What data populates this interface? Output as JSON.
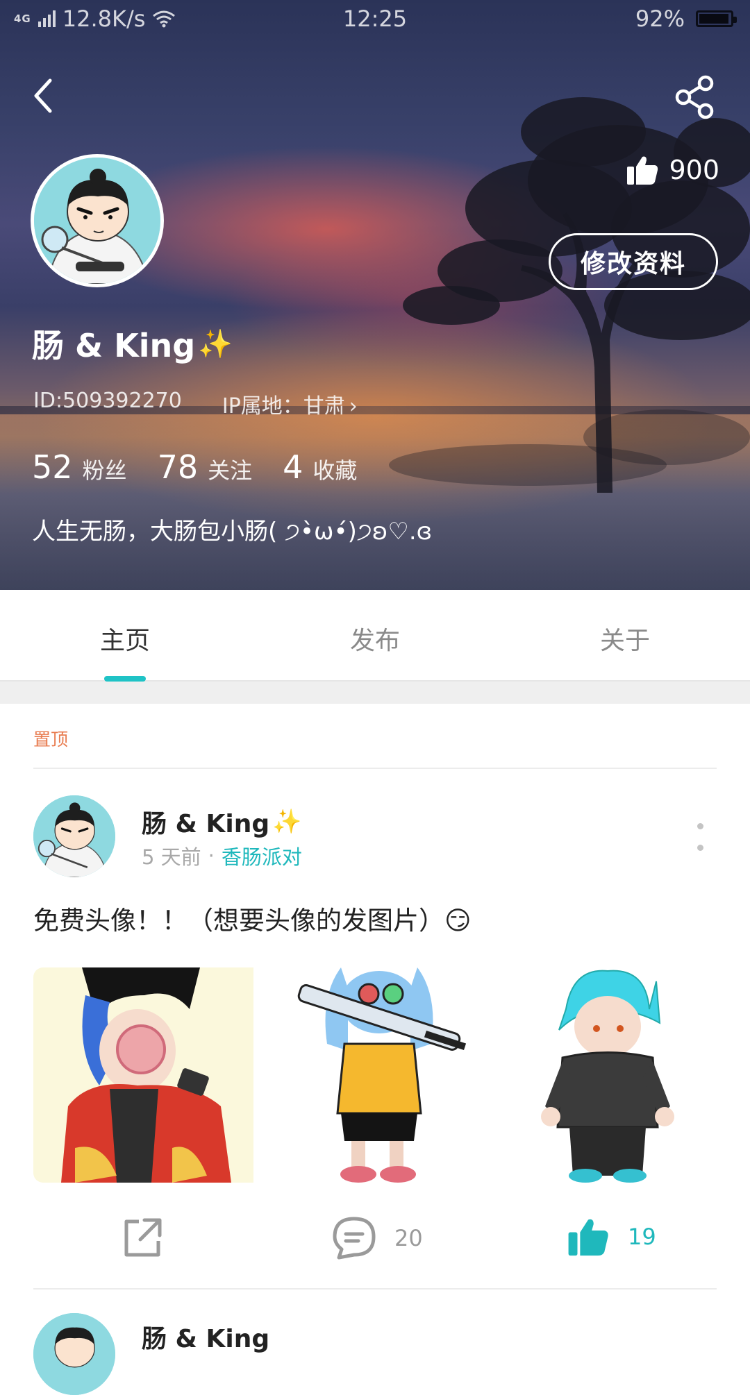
{
  "status_bar": {
    "network": "4G",
    "speed": "12.8K/s",
    "time": "12:25",
    "battery": "92%",
    "battery_level": 0.92
  },
  "profile": {
    "likes": "900",
    "edit_button": "修改资料",
    "username": "肠 & King",
    "username_emoji": "✨",
    "id": "ID:509392270",
    "ip_location": "IP属地：甘肃",
    "stats": [
      {
        "value": "52",
        "label": "粉丝"
      },
      {
        "value": "78",
        "label": "关注"
      },
      {
        "value": "4",
        "label": "收藏"
      }
    ],
    "bio": "人生无肠，大肠包小肠( ੭•̀ω•́)੭ʚ♡.ɞ"
  },
  "tabs": [
    {
      "label": "主页",
      "active": true
    },
    {
      "label": "发布",
      "active": false
    },
    {
      "label": "关于",
      "active": false
    }
  ],
  "feed": {
    "pinned_label": "置顶",
    "post": {
      "author": "肠 & King",
      "author_emoji": "✨",
      "time": "5 天前",
      "separator": "·",
      "topic": "香肠派对",
      "text": "免费头像！！（想要头像的发图片）😏",
      "images": [
        "character-art-1",
        "character-art-2",
        "character-art-3"
      ],
      "comments": "20",
      "likes": "19"
    },
    "next_post_author": "肠 & King"
  },
  "colors": {
    "accent": "#1fc3c6",
    "pinned": "#e87a4d"
  }
}
